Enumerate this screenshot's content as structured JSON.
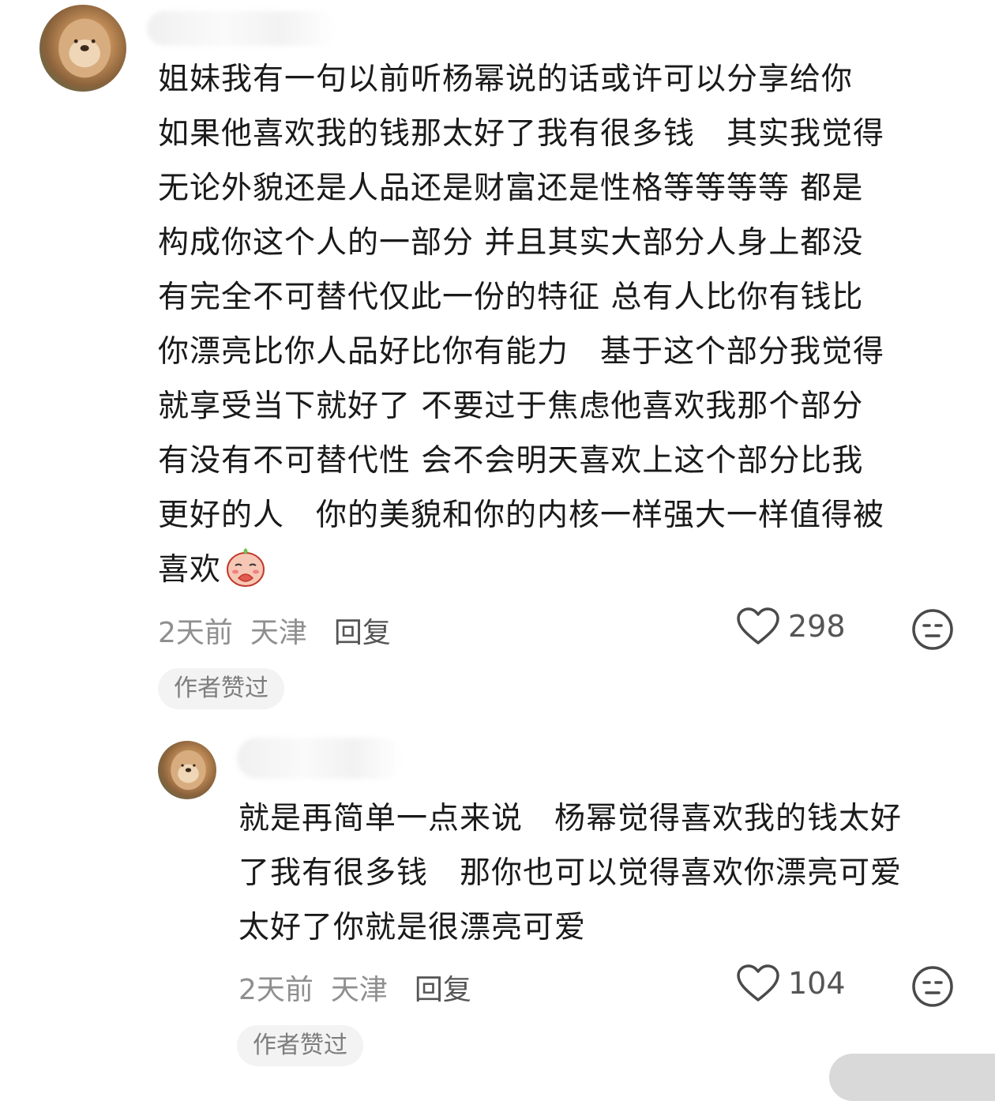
{
  "comment": {
    "text": "姐妹我有一句以前听杨幂说的话或许可以分享给你\n如果他喜欢我的钱那太好了我有很多钱　其实我觉得\n无论外貌还是人品还是财富还是性格等等等等 都是\n构成你这个人的一部分 并且其实大部分人身上都没\n有完全不可替代仅此一份的特征 总有人比你有钱比\n你漂亮比你人品好比你有能力　基于这个部分我觉得\n就享受当下就好了 不要过于焦虑他喜欢我那个部分\n有没有不可替代性 会不会明天喜欢上这个部分比我\n更好的人　你的美貌和你的内核一样强大一样值得被\n喜欢",
    "emoji_icon": "praying-face-sticker-icon",
    "time": "2天前",
    "location": "天津",
    "reply_label": "回复",
    "like_count": "298",
    "badge": "作者赞过"
  },
  "reply": {
    "text": "就是再简单一点来说　杨幂觉得喜欢我的钱太好\n了我有很多钱　那你也可以觉得喜欢你漂亮可爱\n太好了你就是很漂亮可爱",
    "time": "2天前",
    "location": "天津",
    "reply_label": "回复",
    "like_count": "104",
    "badge": "作者赞过"
  },
  "colors": {
    "text": "#1a1a1a",
    "meta": "#8f8f8f",
    "badge_bg": "#f3f3f3"
  }
}
